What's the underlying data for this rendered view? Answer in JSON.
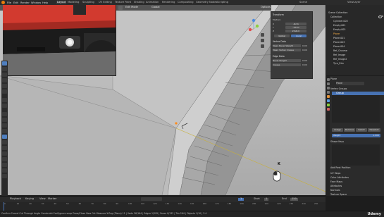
{
  "menu": [
    "File",
    "Edit",
    "Render",
    "Window",
    "Help"
  ],
  "workspaces": [
    "Layout",
    "Modeling",
    "Sculpting",
    "UV Editing",
    "Texture Paint",
    "Shading",
    "Animation",
    "Rendering",
    "Compositing",
    "Geometry Nodes",
    "Scripting"
  ],
  "active_workspace": "Layout",
  "scene": "Scene",
  "view_layer": "ViewLayer",
  "viewport": {
    "header": {
      "mode": "Edit Mode",
      "orientation": "Global",
      "options_label": "Options"
    },
    "npanel": {
      "section": "Transform",
      "median_label": "Median:",
      "rows": [
        {
          "label": "X",
          "value": "-9cm"
        },
        {
          "label": "Y",
          "value": "-37cm"
        },
        {
          "label": "Z",
          "value": "2.64 m"
        }
      ],
      "space_label": "Global",
      "space_alt": "Local",
      "vertex_data_head": "Vertex Data",
      "mean_bevel_weight": {
        "label": "Mean Bevel Weight",
        "value": "0.00"
      },
      "mean_vertex_crease": {
        "label": "Mean Vertex Crease",
        "value": "0.00"
      },
      "edge_data_head": "Edge Data",
      "bevel_weight": {
        "label": "Bevel Weight",
        "value": "0.00"
      },
      "crease": {
        "label": "Crease",
        "value": "0.00"
      }
    },
    "key_overlay": "K"
  },
  "outliner": {
    "title": "Scene Collection",
    "rows": [
      {
        "label": "Collection",
        "sel": false
      },
      {
        "label": "Cylinder.005",
        "sel": false
      },
      {
        "label": "Empty.001",
        "sel": false
      },
      {
        "label": "Empty.005",
        "sel": false
      },
      {
        "label": "Plane",
        "sel": true
      },
      {
        "label": "Plane.001",
        "sel": false
      },
      {
        "label": "Plane.003",
        "sel": false
      },
      {
        "label": "Plane.004",
        "sel": false
      },
      {
        "label": "Ref_Chrome",
        "sel": false
      },
      {
        "label": "Ref_Image",
        "sel": false
      },
      {
        "label": "Ref_Image2",
        "sel": false
      },
      {
        "label": "Tyre_Rim",
        "sel": false
      }
    ]
  },
  "properties": {
    "object_name": "Plane",
    "data_name": "Plane",
    "vertex_groups_head": "Vertex Groups",
    "vertex_group_item": "Group",
    "assign": "Assign",
    "remove": "Remove",
    "select": "Select",
    "deselect": "Deselect",
    "weight_label": "Weight",
    "weight_value": "1.000",
    "shape_keys_head": "Shape Keys",
    "add_rest_position": "Add Rest Position",
    "uv_maps": "UV Maps",
    "color_attributes": "Color Attributes",
    "face_maps": "Face Maps",
    "attributes": "Attributes",
    "normals": "Normals",
    "texture_space": "Texture Space"
  },
  "timeline": {
    "playback": "Playback",
    "keying": "Keying",
    "view": "View",
    "marker": "Marker",
    "current_frame": "1",
    "start_label": "Start",
    "start": "1",
    "end_label": "End",
    "end": "250",
    "ticks": [
      "0",
      "10",
      "20",
      "30",
      "40",
      "50",
      "60",
      "70",
      "80",
      "90",
      "100",
      "110",
      "120",
      "130",
      "140",
      "150",
      "160",
      "170",
      "180",
      "190",
      "200",
      "210",
      "220",
      "230",
      "240",
      "250"
    ]
  },
  "status_bar": "Confirm  Cancel  Cut Through  Angle Constraint  Excl/Ignore snap  Draw/Close  New Cut  Measure  X-Ray  (Plane) 11 | Verts 26/164 | Edges 1/295 | Faces 0/132 | Tris 264 | Objects 1/10 | 3.4",
  "brand": "Udemy",
  "colors": {
    "accent": "#4772b3",
    "selected_orange": "#ffb347",
    "axis_x": "#e04c4c",
    "axis_y": "#8bcf3f",
    "axis_z": "#4c8be0"
  }
}
